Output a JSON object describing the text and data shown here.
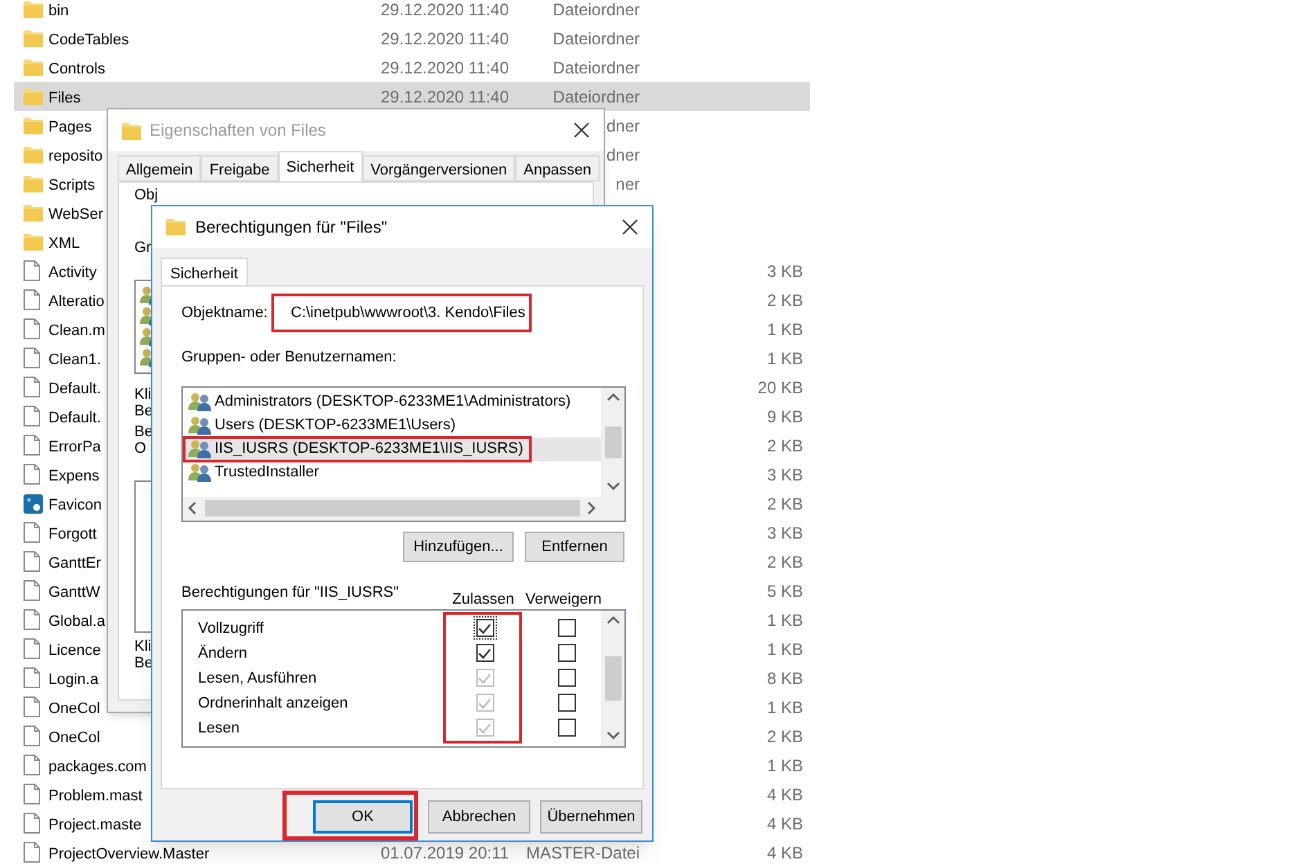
{
  "explorer": {
    "rows": [
      {
        "kind": "folder",
        "name": "bin",
        "date": "29.12.2020 11:40",
        "type": "Dateiordner",
        "selected": false
      },
      {
        "kind": "folder",
        "name": "CodeTables",
        "date": "29.12.2020 11:40",
        "type": "Dateiordner",
        "selected": false
      },
      {
        "kind": "folder",
        "name": "Controls",
        "date": "29.12.2020 11:40",
        "type": "Dateiordner",
        "selected": false
      },
      {
        "kind": "folder",
        "name": "Files",
        "date": "29.12.2020 11:40",
        "type": "Dateiordner",
        "selected": true
      },
      {
        "kind": "folder",
        "name": "Pages",
        "type": "dner",
        "selected": false
      },
      {
        "kind": "folder",
        "name": "reposito",
        "type": "dner",
        "selected": false
      },
      {
        "kind": "folder",
        "name": "Scripts",
        "type": "ner",
        "selected": false
      },
      {
        "kind": "folder",
        "name": "WebSer",
        "selected": false
      },
      {
        "kind": "folder",
        "name": "XML",
        "selected": false
      },
      {
        "kind": "file",
        "name": "Activity",
        "size": "3 KB",
        "selected": false
      },
      {
        "kind": "file",
        "name": "Alteratio",
        "size": "2 KB",
        "selected": false
      },
      {
        "kind": "file",
        "name": "Clean.m",
        "size": "1 KB",
        "selected": false
      },
      {
        "kind": "file",
        "name": "Clean1.",
        "size": "1 KB",
        "selected": false
      },
      {
        "kind": "file",
        "name": "Default.",
        "size": "20 KB",
        "selected": false
      },
      {
        "kind": "file",
        "name": "Default.",
        "size": "9 KB",
        "selected": false
      },
      {
        "kind": "file",
        "name": "ErrorPa",
        "size": "2 KB",
        "selected": false
      },
      {
        "kind": "file",
        "name": "Expens",
        "size": "3 KB",
        "selected": false
      },
      {
        "kind": "image",
        "name": "Favicon",
        "size": "2 KB",
        "selected": false
      },
      {
        "kind": "file",
        "name": "Forgott",
        "size": "3 KB",
        "selected": false
      },
      {
        "kind": "file",
        "name": "GanttEr",
        "size": "2 KB",
        "selected": false
      },
      {
        "kind": "file",
        "name": "GanttW",
        "size": "5 KB",
        "selected": false
      },
      {
        "kind": "file",
        "name": "Global.a",
        "size": "1 KB",
        "selected": false
      },
      {
        "kind": "file",
        "name": "Licence",
        "size": "1 KB",
        "selected": false
      },
      {
        "kind": "file",
        "name": "Login.a",
        "size": "8 KB",
        "selected": false
      },
      {
        "kind": "file",
        "name": "OneCol",
        "size": "1 KB",
        "selected": false
      },
      {
        "kind": "file",
        "name": "OneCol",
        "size": "2 KB",
        "selected": false
      },
      {
        "kind": "file",
        "name": "packages.com",
        "size": "1 KB",
        "selected": false
      },
      {
        "kind": "file",
        "name": "Problem.mast",
        "size": "4 KB",
        "selected": false
      },
      {
        "kind": "file",
        "name": "Project.maste",
        "size": "4 KB",
        "selected": false
      },
      {
        "kind": "file",
        "name": "ProjectOverview.Master",
        "date": "01.07.2019 20:11",
        "type": "MASTER-Datei",
        "size": "4 KB",
        "selected": false
      }
    ]
  },
  "properties_dialog": {
    "title": "Eigenschaften von Files",
    "tabs": [
      {
        "label": "Allgemein",
        "selected": false
      },
      {
        "label": "Freigabe",
        "selected": false
      },
      {
        "label": "Sicherheit",
        "selected": true
      },
      {
        "label": "Vorgängerversionen",
        "selected": false
      },
      {
        "label": "Anpassen",
        "selected": false
      }
    ],
    "object_label": "Obj",
    "groups_label": "Gr",
    "notes": [
      [
        "Kli",
        "Be"
      ],
      [
        "Be",
        "O"
      ],
      [
        "Kli",
        "Be"
      ]
    ]
  },
  "permissions_dialog": {
    "title": "Berechtigungen für \"Files\"",
    "tabs": [
      {
        "label": "Sicherheit",
        "selected": true
      }
    ],
    "object_label": "Objektname:",
    "object_value": "C:\\inetpub\\wwwroot\\3. Kendo\\Files",
    "object_highlighted": true,
    "groups_label": "Gruppen- oder Benutzernamen:",
    "groups": [
      {
        "name": "Administrators (DESKTOP-6233ME1\\Administrators)",
        "selected": false,
        "highlighted": false
      },
      {
        "name": "Users (DESKTOP-6233ME1\\Users)",
        "selected": false,
        "highlighted": false
      },
      {
        "name": "IIS_IUSRS (DESKTOP-6233ME1\\IIS_IUSRS)",
        "selected": true,
        "highlighted": true
      },
      {
        "name": "TrustedInstaller",
        "selected": false,
        "highlighted": false
      }
    ],
    "group_buttons": [
      "Hinzufügen...",
      "Entfernen"
    ],
    "permissions_label": "Berechtigungen für \"IIS_IUSRS\"",
    "columns": [
      "Zulassen",
      "Verweigern"
    ],
    "allow_highlighted": true,
    "permissions": [
      {
        "name": "Vollzugriff",
        "allow": {
          "checked": true,
          "disabled": false,
          "focused": true
        },
        "deny": {
          "checked": false,
          "disabled": false,
          "focused": false
        }
      },
      {
        "name": "Ändern",
        "allow": {
          "checked": true,
          "disabled": false,
          "focused": false
        },
        "deny": {
          "checked": false,
          "disabled": false,
          "focused": false
        }
      },
      {
        "name": "Lesen, Ausführen",
        "allow": {
          "checked": true,
          "disabled": true,
          "focused": false
        },
        "deny": {
          "checked": false,
          "disabled": false,
          "focused": false
        }
      },
      {
        "name": "Ordnerinhalt anzeigen",
        "allow": {
          "checked": true,
          "disabled": true,
          "focused": false
        },
        "deny": {
          "checked": false,
          "disabled": false,
          "focused": false
        }
      },
      {
        "name": "Lesen",
        "allow": {
          "checked": true,
          "disabled": true,
          "focused": false
        },
        "deny": {
          "checked": false,
          "disabled": false,
          "focused": false
        }
      }
    ],
    "buttons": [
      {
        "label": "OK",
        "default": true,
        "highlighted": true
      },
      {
        "label": "Abbrechen",
        "default": false,
        "highlighted": false
      },
      {
        "label": "Übernehmen",
        "default": false,
        "highlighted": false
      }
    ]
  }
}
